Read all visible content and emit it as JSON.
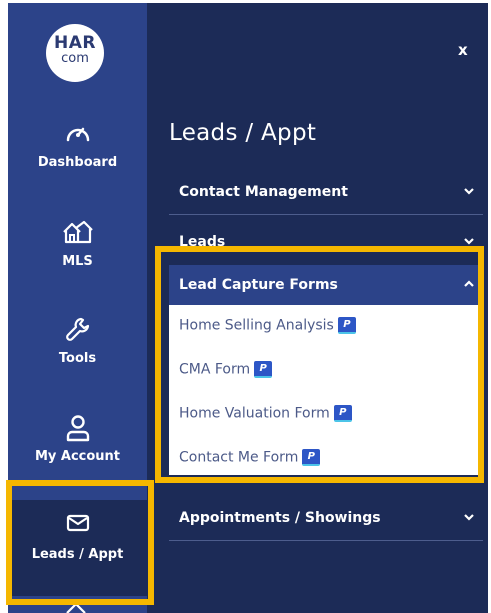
{
  "logo": {
    "line1": "HAR",
    "line2": "com"
  },
  "close_label": "x",
  "rail": {
    "items": [
      {
        "label": "Dashboard",
        "icon": "gauge-icon"
      },
      {
        "label": "MLS",
        "icon": "houses-icon"
      },
      {
        "label": "Tools",
        "icon": "wrench-icon"
      },
      {
        "label": "My Account",
        "icon": "user-icon"
      },
      {
        "label": "Leads / Appt",
        "icon": "envelope-icon",
        "active": true
      }
    ]
  },
  "panel": {
    "title": "Leads / Appt",
    "sections": [
      {
        "label": "Contact Management",
        "expanded": false
      },
      {
        "label": "Leads",
        "expanded": false
      },
      {
        "label": "Lead Capture Forms",
        "expanded": true,
        "items": [
          {
            "label": "Home Selling Analysis",
            "badge": "P"
          },
          {
            "label": "CMA Form",
            "badge": "P"
          },
          {
            "label": "Home Valuation Form",
            "badge": "P"
          },
          {
            "label": "Contact Me Form",
            "badge": "P"
          }
        ]
      },
      {
        "label": "Appointments / Showings",
        "expanded": false
      }
    ]
  },
  "colors": {
    "rail_bg": "#2c4389",
    "panel_bg": "#1c2b57",
    "highlight": "#f5b700",
    "badge_bg": "#2d56c6",
    "submenu_text": "#4c5a88"
  }
}
